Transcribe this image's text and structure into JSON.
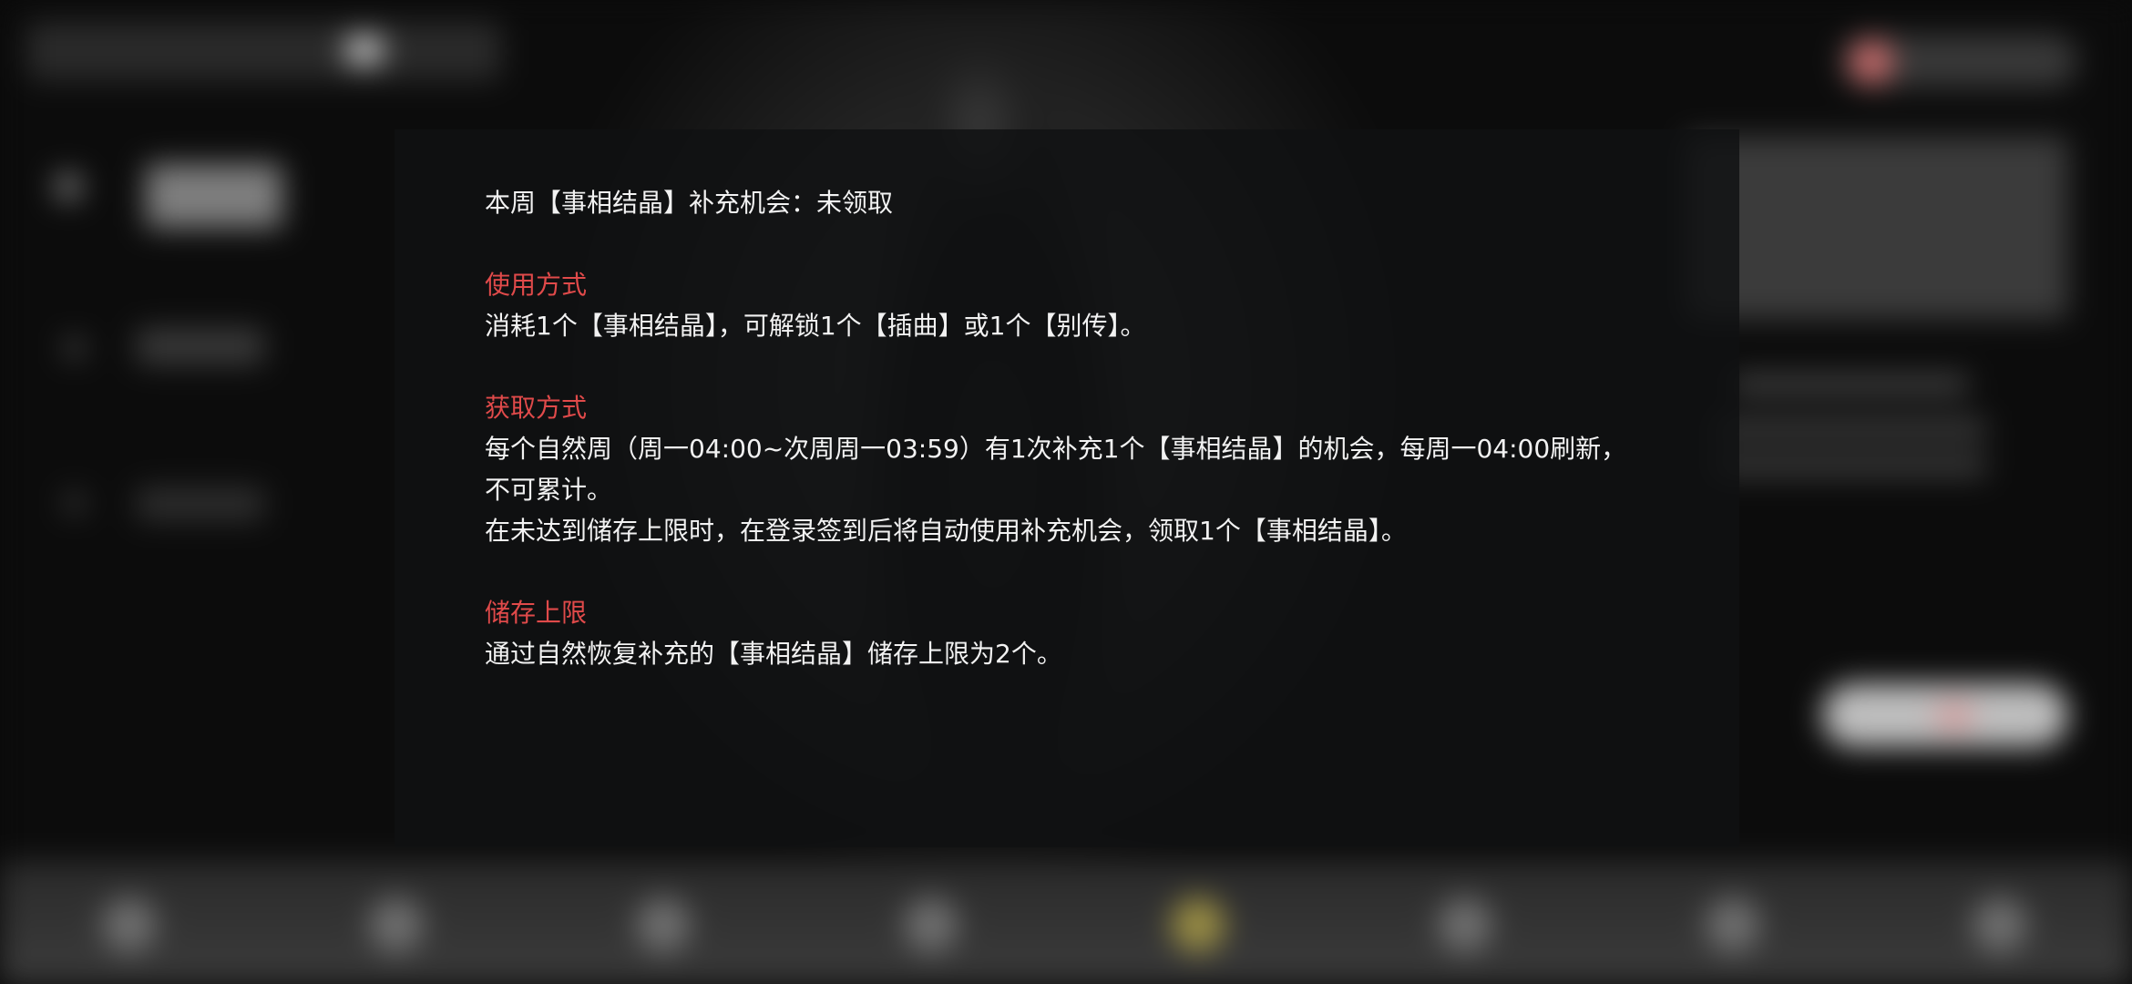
{
  "dialog": {
    "status_line": "本周【事相结晶】补充机会：未领取",
    "sections": [
      {
        "heading": "使用方式",
        "lines": [
          "消耗1个【事相结晶】，可解锁1个【插曲】或1个【别传】。"
        ]
      },
      {
        "heading": "获取方式",
        "lines": [
          "每个自然周（周一04:00~次周周一03:59）有1次补充1个【事相结晶】的机会，每周一04:00刷新，",
          "不可累计。",
          "在未达到储存上限时，在登录签到后将自动使用补充机会，领取1个【事相结晶】。"
        ]
      },
      {
        "heading": "储存上限",
        "lines": [
          "通过自然恢复补充的【事相结晶】储存上限为2个。"
        ]
      }
    ]
  },
  "colors": {
    "heading": "#e04a4a",
    "body_text": "#f2f2f2",
    "panel_bg": "#101112"
  }
}
